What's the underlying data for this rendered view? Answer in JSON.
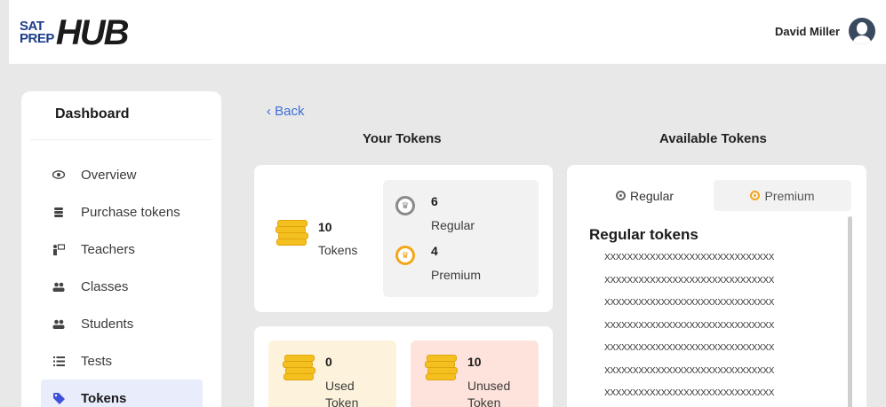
{
  "header": {
    "logo_small_top": "SAT",
    "logo_small_bottom": "PREP",
    "logo_big": "HUB",
    "user_name": "David Miller"
  },
  "sidebar": {
    "title": "Dashboard",
    "items": [
      {
        "label": "Overview",
        "icon": "eye-icon"
      },
      {
        "label": "Purchase tokens",
        "icon": "coins-icon"
      },
      {
        "label": "Teachers",
        "icon": "teacher-icon"
      },
      {
        "label": "Classes",
        "icon": "group-icon"
      },
      {
        "label": "Students",
        "icon": "group-icon"
      },
      {
        "label": "Tests",
        "icon": "list-icon"
      },
      {
        "label": "Tokens",
        "icon": "tag-icon",
        "active": true
      }
    ]
  },
  "main": {
    "back_label": "‹ Back",
    "your_tokens_heading": "Your Tokens",
    "available_tokens_heading": "Available Tokens",
    "summary": {
      "total_value": "10",
      "total_label": "Tokens",
      "regular_value": "6",
      "regular_label": "Regular",
      "premium_value": "4",
      "premium_label": "Premium"
    },
    "usage": {
      "used_value": "0",
      "used_label_1": "Used",
      "used_label_2": "Token",
      "unused_value": "10",
      "unused_label_1": "Unused",
      "unused_label_2": "Token"
    },
    "available": {
      "tab_regular": "Regular",
      "tab_premium": "Premium",
      "list_title": "Regular tokens",
      "tokens": [
        "XXXXXXXXXXXXXXXXXXXXXXXXXXXXXX",
        "XXXXXXXXXXXXXXXXXXXXXXXXXXXXXX",
        "XXXXXXXXXXXXXXXXXXXXXXXXXXXXXX",
        "XXXXXXXXXXXXXXXXXXXXXXXXXXXXXX",
        "XXXXXXXXXXXXXXXXXXXXXXXXXXXXXX",
        "XXXXXXXXXXXXXXXXXXXXXXXXXXXXXX",
        "XXXXXXXXXXXXXXXXXXXXXXXXXXXXXX"
      ]
    }
  },
  "colors": {
    "accent_blue": "#3b6fd9",
    "premium_orange": "#f2a71b",
    "coin_gold": "#f4c020",
    "active_nav_bg": "#e9ecfb"
  }
}
